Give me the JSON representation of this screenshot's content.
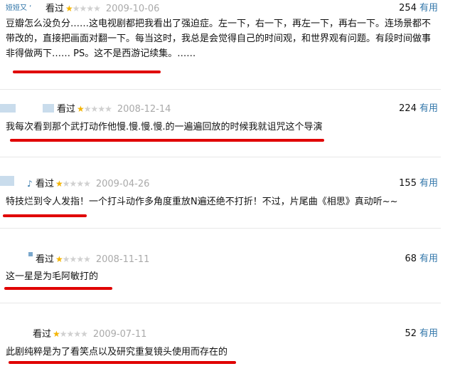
{
  "reviews": [
    {
      "user_fragment": "娅娅又 ‘",
      "seen_label": "看过",
      "rating": 1,
      "date": "2009-10-06",
      "votes": "254",
      "useful_label": "有用",
      "text": "豆瓣怎么没负分……这电视剧都把我看出了强迫症。左一下，右一下，再左一下，再右一下。连场景都不带改的，直接把画面对翻一下。每当这时，我总是会觉得自己的时间观，和世界观有问题。有段时间做事非得做两下…… PS。这不是西游记续集。……"
    },
    {
      "seen_label": "看过",
      "rating": 1,
      "date": "2008-12-14",
      "votes": "224",
      "useful_label": "有用",
      "text": "我每次看到那个武打动作他慢.慢.慢.慢.的一遍遍回放的时候我就诅咒这个导演"
    },
    {
      "user_fragment": "♪",
      "seen_label": "看过",
      "rating": 1,
      "date": "2009-04-26",
      "votes": "155",
      "useful_label": "有用",
      "text": "特技烂到令人发指！一个打斗动作多角度重放N遍还绝不打折！不过，片尾曲《相思》真动听~~"
    },
    {
      "seen_label": "看过",
      "rating": 1,
      "date": "2008-11-11",
      "votes": "68",
      "useful_label": "有用",
      "text": "这一星是为毛阿敏打的"
    },
    {
      "seen_label": "看过",
      "rating": 1,
      "date": "2009-07-11",
      "votes": "52",
      "useful_label": "有用",
      "text": "此剧纯粹是为了看笑点以及研究重复镜头使用而存在的"
    }
  ],
  "colors": {
    "link": "#3377aa",
    "date": "#aaaaaa",
    "star_on": "#f4b400",
    "star_off": "#d0d0d0",
    "annotation": "#e00000"
  },
  "icons": {
    "star_filled": "star-filled-icon",
    "star_empty": "star-empty-icon"
  }
}
